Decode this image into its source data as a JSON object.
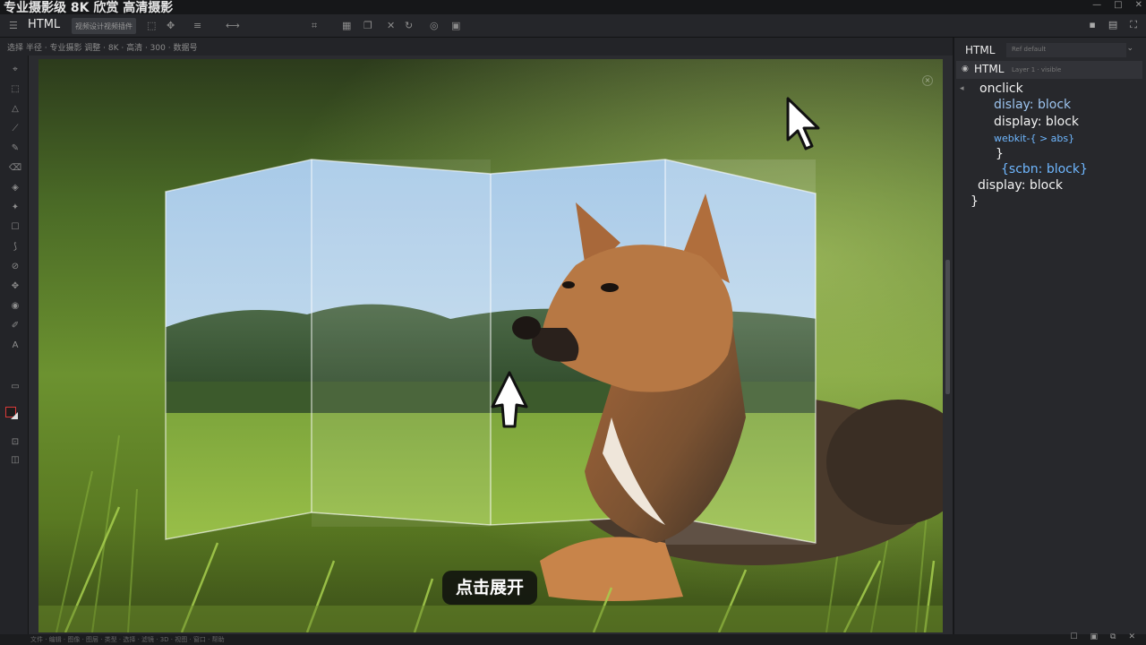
{
  "title": "专业摄影级 8K 欣赏 高清摄影",
  "window_controls": [
    "—",
    "□",
    "✕"
  ],
  "toolbar": {
    "app_label": "HTML",
    "search_value": "视频设计视频插件",
    "icons": [
      "menu-icon",
      "frame-icon",
      "move-icon",
      "align-icon",
      "transform-icon",
      "warp-icon",
      "close-icon",
      "rotate-icon",
      "camera-icon",
      "video-icon"
    ],
    "right_icons": [
      "save-icon",
      "layout-icon",
      "fullscreen-icon"
    ]
  },
  "options_bar": "选择 半径 · 专业摄影 调整 · 8K · 高清 · 300 · 数据号",
  "tools": [
    "⌖",
    "⬚",
    "△",
    "⟋",
    "✎",
    "⌫",
    "◈",
    "✦",
    "☐",
    "⟆",
    "⊘",
    "✥",
    "◉",
    "✐",
    "A",
    "▭"
  ],
  "canvas": {
    "button_label": "点击展开"
  },
  "panel": {
    "header_label": "HTML",
    "dropdown_value": "Ref default",
    "layer_name": "HTML",
    "layer_sub": "Layer 1 · visible",
    "code": {
      "l1": "onclick",
      "l2": "dislay: block",
      "l3": "display: block",
      "l4": "webkit-{ > abs}",
      "l5": "}",
      "l6": "{scbn: block}",
      "l7": "display: block",
      "l8": "}"
    }
  },
  "footer": "文件 · 编辑 · 图像 · 图层 · 类型 · 选择 · 滤镜 · 3D · 视图 · 窗口 · 帮助",
  "colors": {
    "panel_bg": "#27282c",
    "canvas_bg": "#2b2c30",
    "accent_red": "#d93a3a"
  }
}
